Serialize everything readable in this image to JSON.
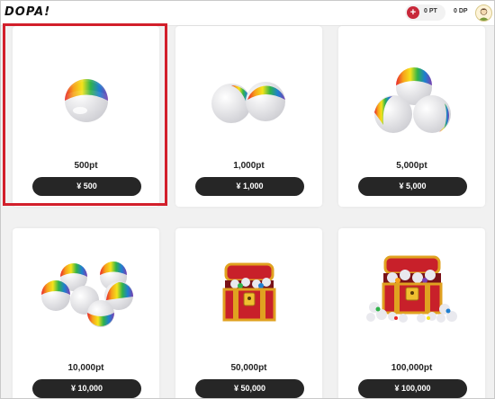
{
  "header": {
    "logo": "DOPA!",
    "points_value": "0 PT",
    "dp_value": "0 DP",
    "plus_label": "+"
  },
  "colors": {
    "button_bg": "#262626",
    "selection_border": "#d21f2b",
    "plus_icon": "#c8283a"
  },
  "packages": [
    {
      "amount": "500pt",
      "price": "¥ 500",
      "art": "single-rainbow-ball",
      "selected": true
    },
    {
      "amount": "1,000pt",
      "price": "¥ 1,000",
      "art": "two-rainbow-balls",
      "selected": false
    },
    {
      "amount": "5,000pt",
      "price": "¥ 5,000",
      "art": "three-rainbow-balls",
      "selected": false
    },
    {
      "amount": "10,000pt",
      "price": "¥ 10,000",
      "art": "pile-of-rainbow-balls",
      "selected": false
    },
    {
      "amount": "50,000pt",
      "price": "¥ 50,000",
      "art": "treasure-chest-with-balls",
      "selected": false
    },
    {
      "amount": "100,000pt",
      "price": "¥ 100,000",
      "art": "large-treasure-chest-with-balls",
      "selected": false
    }
  ]
}
